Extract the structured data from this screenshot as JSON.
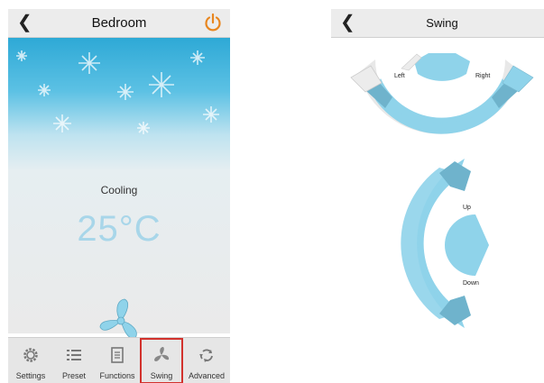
{
  "left_screen": {
    "title": "Bedroom",
    "back_icon": "chevron-left-icon",
    "power_icon": "power-icon",
    "power_color": "#e8861f",
    "mode": "Cooling",
    "temperature": "25°C",
    "temperature_color": "#a8d6e9",
    "fan_icon": "fan-icon",
    "tabs": [
      {
        "label": "Settings",
        "icon": "gear-icon",
        "selected": false
      },
      {
        "label": "Preset",
        "icon": "list-icon",
        "selected": false
      },
      {
        "label": "Functions",
        "icon": "document-icon",
        "selected": false
      },
      {
        "label": "Swing",
        "icon": "swing-icon",
        "selected": true
      },
      {
        "label": "Advanced",
        "icon": "recycle-icon",
        "selected": false
      }
    ]
  },
  "right_screen": {
    "title": "Swing",
    "back_icon": "chevron-left-icon",
    "horizontal": {
      "left_label": "Left",
      "right_label": "Right"
    },
    "vertical": {
      "up_label": "Up",
      "down_label": "Down"
    },
    "accent_color": "#8fd3ea"
  }
}
